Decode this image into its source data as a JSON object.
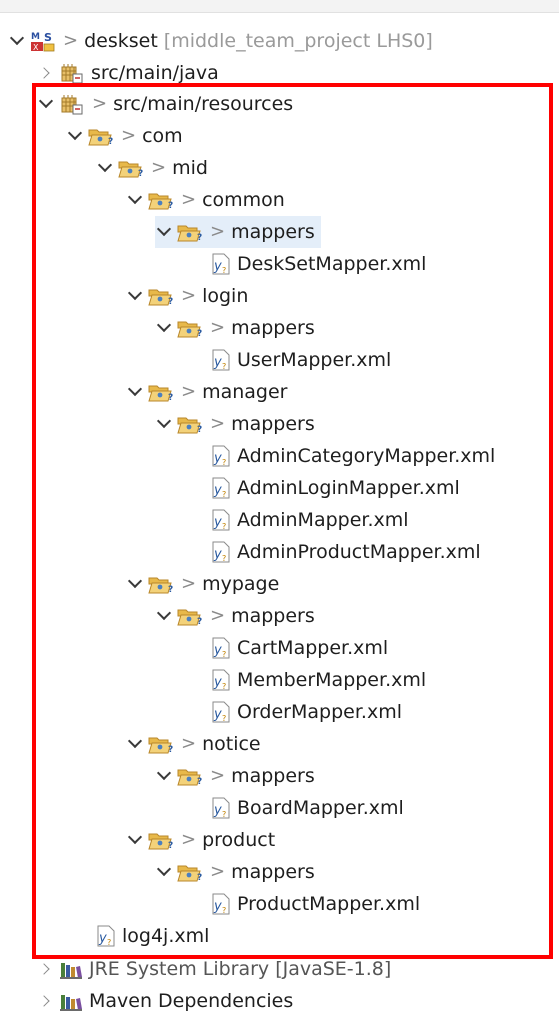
{
  "tree": {
    "top_cut_text": "",
    "project": {
      "label": "deskset",
      "meta": "[middle_team_project LHS0]"
    },
    "src_main_java": {
      "label": "src/main/java"
    },
    "src_main_resources": {
      "label": "src/main/resources"
    },
    "com": {
      "label": "com"
    },
    "mid": {
      "label": "mid"
    },
    "common": {
      "label": "common",
      "mappers": "mappers",
      "files": [
        "DeskSetMapper.xml"
      ]
    },
    "login": {
      "label": "login",
      "mappers": "mappers",
      "files": [
        "UserMapper.xml"
      ]
    },
    "manager": {
      "label": "manager",
      "mappers": "mappers",
      "files": [
        "AdminCategoryMapper.xml",
        "AdminLoginMapper.xml",
        "AdminMapper.xml",
        "AdminProductMapper.xml"
      ]
    },
    "mypage": {
      "label": "mypage",
      "mappers": "mappers",
      "files": [
        "CartMapper.xml",
        "MemberMapper.xml",
        "OrderMapper.xml"
      ]
    },
    "notice": {
      "label": "notice",
      "mappers": "mappers",
      "files": [
        "BoardMapper.xml"
      ]
    },
    "product": {
      "label": "product",
      "mappers": "mappers",
      "files": [
        "ProductMapper.xml"
      ]
    },
    "log4j": {
      "label": "log4j.xml"
    },
    "jre": {
      "label": "JRE System Library",
      "meta": "[JavaSE-1.8]"
    },
    "maven": {
      "label": "Maven Dependencies"
    }
  },
  "icons": {
    "project": "maven-project-icon",
    "source_folder": "source-folder-icon",
    "package": "package-icon",
    "xml_file": "xml-file-icon",
    "library": "library-icon"
  },
  "colors": {
    "highlight": "#ff0000",
    "selection": "#e4eef9"
  }
}
